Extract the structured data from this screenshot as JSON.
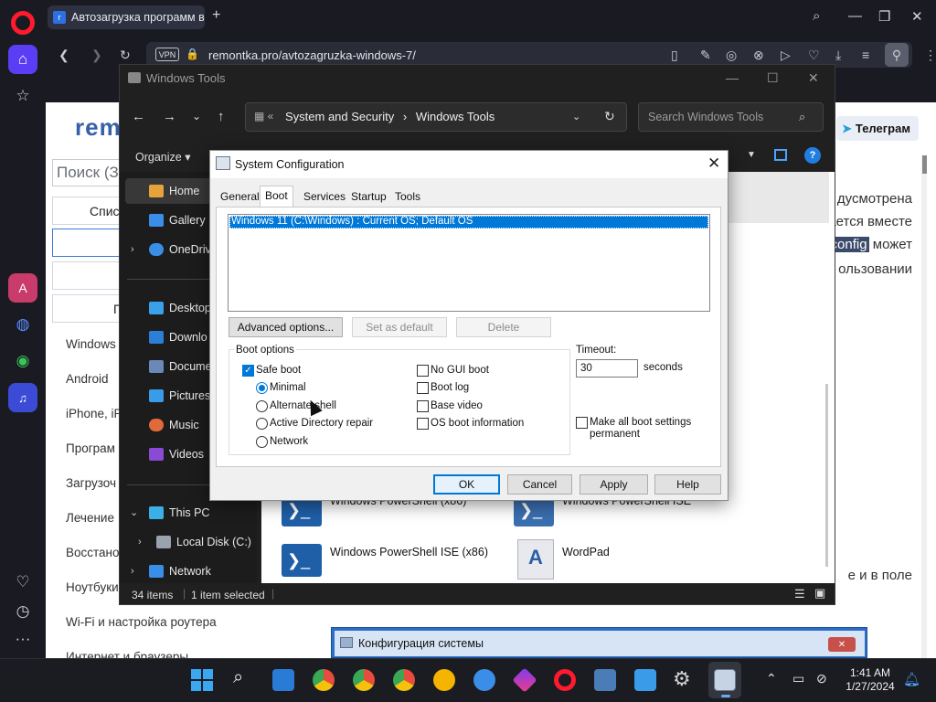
{
  "browser": {
    "tab_title": "Автозагрузка программ в",
    "url": "remontka.pro/avtozagruzka-windows-7/",
    "vpn_label": "VPN"
  },
  "website": {
    "logo": "rem",
    "search_placeholder": "Поиск (З",
    "boxes": [
      "Спис",
      "",
      "",
      "П"
    ],
    "menu": [
      "Windows",
      "Android",
      "iPhone, iP",
      "Програм",
      "Загрузоч",
      "Лечение",
      "Восстано",
      "Ноутбуки",
      "Wi-Fi и настройка роутера",
      "Интернет и браузеры"
    ],
    "telegram_button": "Телеграм",
    "article_lines": [
      "дусмотрена",
      "ается вместе",
      "config",
      "может",
      "ользовании",
      "е и в поле"
    ]
  },
  "explorer": {
    "title": "Windows Tools",
    "breadcrumb": [
      "System and Security",
      "Windows Tools"
    ],
    "search_placeholder": "Search Windows Tools",
    "organize_label": "Organize",
    "nav_items": [
      {
        "label": "Home",
        "icon": "home-icon"
      },
      {
        "label": "Gallery",
        "icon": "gallery-icon"
      },
      {
        "label": "OneDriv",
        "icon": "onedrive-icon"
      },
      {
        "label": "Desktop",
        "icon": "desktop-icon"
      },
      {
        "label": "Downlo",
        "icon": "downloads-icon"
      },
      {
        "label": "Docume",
        "icon": "documents-icon"
      },
      {
        "label": "Pictures",
        "icon": "pictures-icon"
      },
      {
        "label": "Music",
        "icon": "music-icon"
      },
      {
        "label": "Videos",
        "icon": "videos-icon"
      },
      {
        "label": "This PC",
        "icon": "this-pc-icon"
      },
      {
        "label": "Local Disk (C:)",
        "icon": "disk-icon"
      },
      {
        "label": "Network",
        "icon": "network-icon"
      }
    ],
    "tools": [
      "Windows PowerShell (x86)",
      "Windows PowerShell ISE",
      "Windows PowerShell ISE (x86)",
      "WordPad"
    ],
    "status_count": "34 items",
    "status_selected": "1 item selected"
  },
  "msconfig": {
    "title": "System Configuration",
    "tabs": [
      "General",
      "Boot",
      "Services",
      "Startup",
      "Tools"
    ],
    "active_tab": "Boot",
    "os_entries": [
      "Windows 11 (C:\\Windows) : Current OS; Default OS"
    ],
    "buttons": {
      "advanced": "Advanced options...",
      "set_default": "Set as default",
      "delete": "Delete"
    },
    "boot_options_label": "Boot options",
    "safe_boot": {
      "label": "Safe boot",
      "checked": true
    },
    "radios": [
      {
        "label": "Minimal",
        "checked": true
      },
      {
        "label": "Alternate shell",
        "checked": false
      },
      {
        "label": "Active Directory repair",
        "checked": false
      },
      {
        "label": "Network",
        "checked": false
      }
    ],
    "checkboxes_right": [
      {
        "label": "No GUI boot",
        "checked": false
      },
      {
        "label": "Boot log",
        "checked": false
      },
      {
        "label": "Base video",
        "checked": false
      },
      {
        "label": "OS boot information",
        "checked": false
      }
    ],
    "timeout_label": "Timeout:",
    "timeout_value": "30",
    "timeout_unit": "seconds",
    "permanent": {
      "label_line1": "Make all boot settings",
      "label_line2": "permanent",
      "checked": false
    },
    "footer": {
      "ok": "OK",
      "cancel": "Cancel",
      "apply": "Apply",
      "help": "Help"
    }
  },
  "ru_window": {
    "title": "Конфигурация системы"
  },
  "taskbar": {
    "time": "1:41 AM",
    "date": "1/27/2024"
  },
  "colors": {
    "accent": "#0078d7",
    "opera_red": "#ff1b2d",
    "selection": "#0078d7"
  }
}
